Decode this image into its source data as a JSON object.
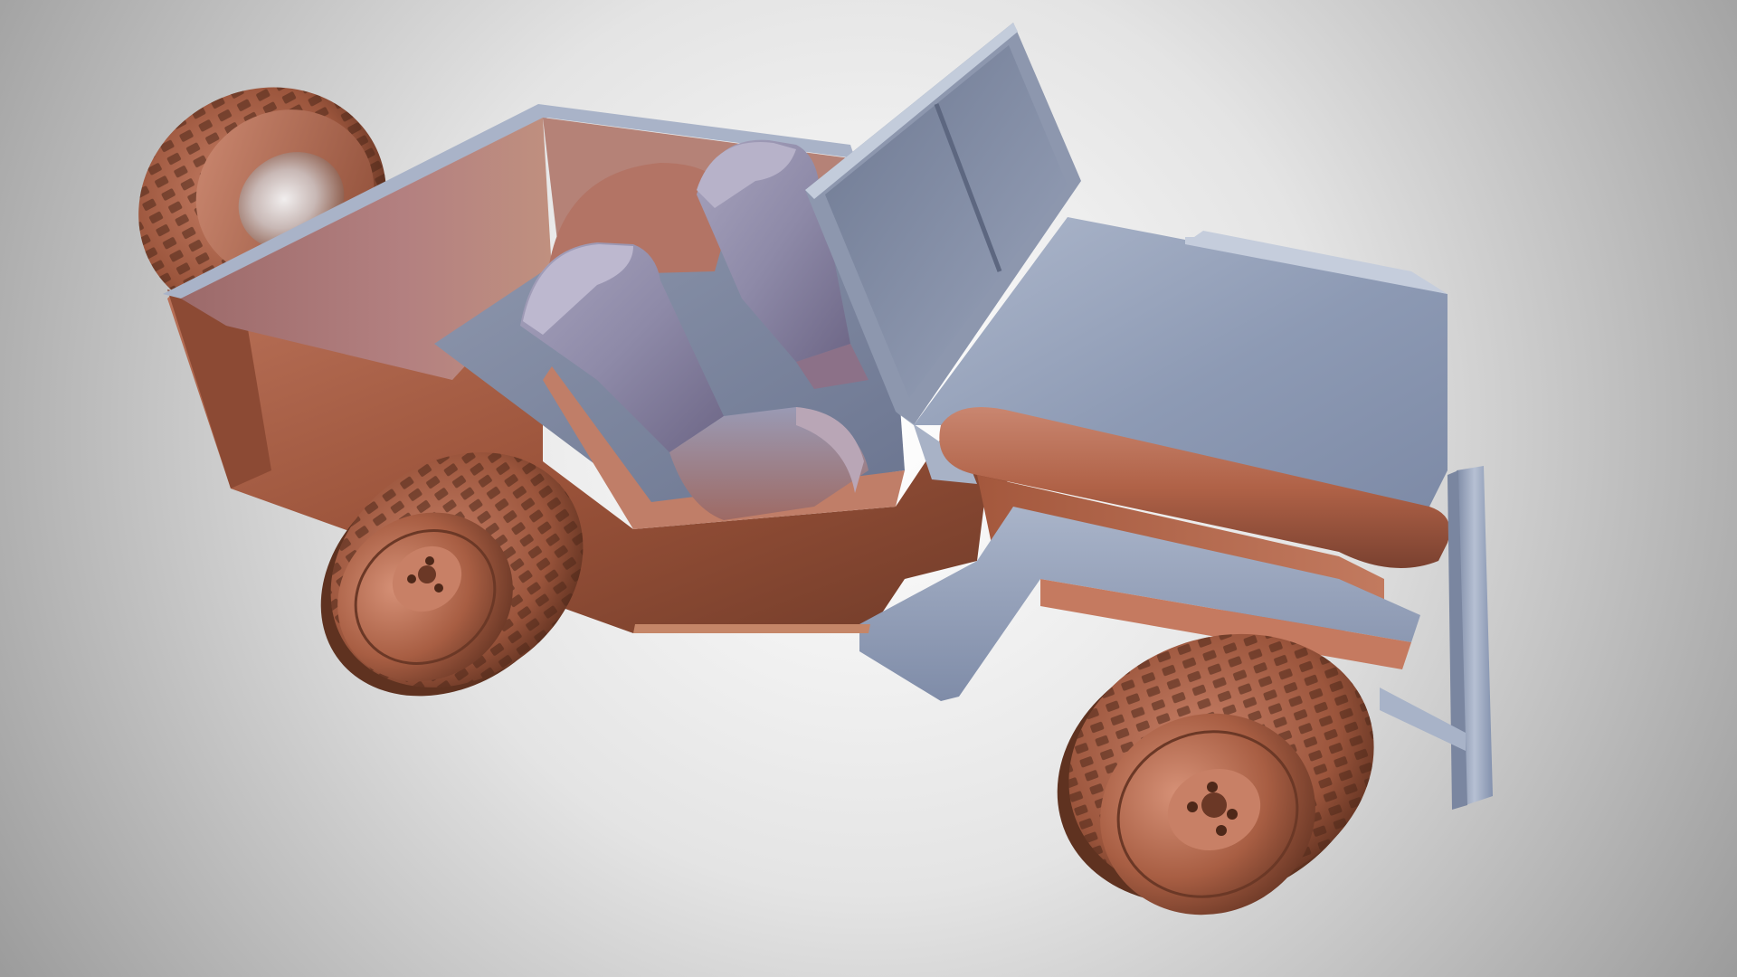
{
  "scene": {
    "subject": "3d-jeep-model",
    "background": {
      "center": "#ffffff",
      "mid": "#dcdcdc",
      "edge": "#9a9a9a"
    },
    "material": {
      "warm_light": "#d38a70",
      "warm_mid": "#b5664a",
      "warm_dark": "#6e3a28",
      "cool_light": "#b4c0d4",
      "cool_mid": "#8d9cb6",
      "cool_dark": "#5a6782"
    }
  }
}
